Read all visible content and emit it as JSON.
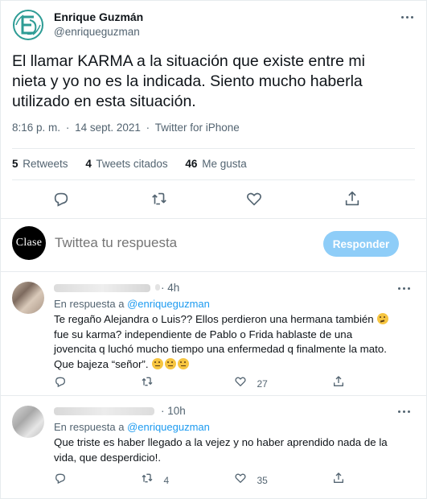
{
  "tweet": {
    "author_name": "Enrique Guzmán",
    "author_handle": "@enriqueguzman",
    "text": "El llamar KARMA a la situación que existe entre mi nieta y yo no es la indicada. Siento mucho haberla utilizado en esta situación.",
    "time": "8:16 p. m.",
    "separator": "·",
    "date": "14 sept. 2021",
    "source": "Twitter for iPhone",
    "stats": {
      "retweets_count": "5",
      "retweets_label": "Retweets",
      "quotes_count": "4",
      "quotes_label": "Tweets citados",
      "likes_count": "46",
      "likes_label": "Me gusta"
    }
  },
  "composer": {
    "avatar_text": "Clase",
    "placeholder": "Twittea tu respuesta",
    "button_label": "Responder"
  },
  "replies": [
    {
      "time": "4h",
      "in_reply_prefix": "En respuesta a",
      "in_reply_handle": "@enriqueguzman",
      "text_parts": [
        "Te regaño Alejandra o Luis?? Ellos perdieron  una hermana también ",
        " fue su karma? independiente de Pablo o Frida hablaste de una jovencita q luchó mucho tiempo una enfermedad q finalmente la mato. Que bajeza “señor”. "
      ],
      "like_count": "27"
    },
    {
      "time": "10h",
      "in_reply_prefix": "En respuesta a",
      "in_reply_handle": "@enriqueguzman",
      "text": "Que triste es haber llegado a la vejez y no haber aprendido nada de la vida, que desperdicio!.",
      "retweet_count": "4",
      "like_count": "35"
    }
  ],
  "colors": {
    "accent": "#1d9bf0",
    "button_disabled": "#8ecdf8",
    "secondary_text": "#536471",
    "divider": "#e7ebee",
    "logo_teal": "#2e9c95"
  }
}
